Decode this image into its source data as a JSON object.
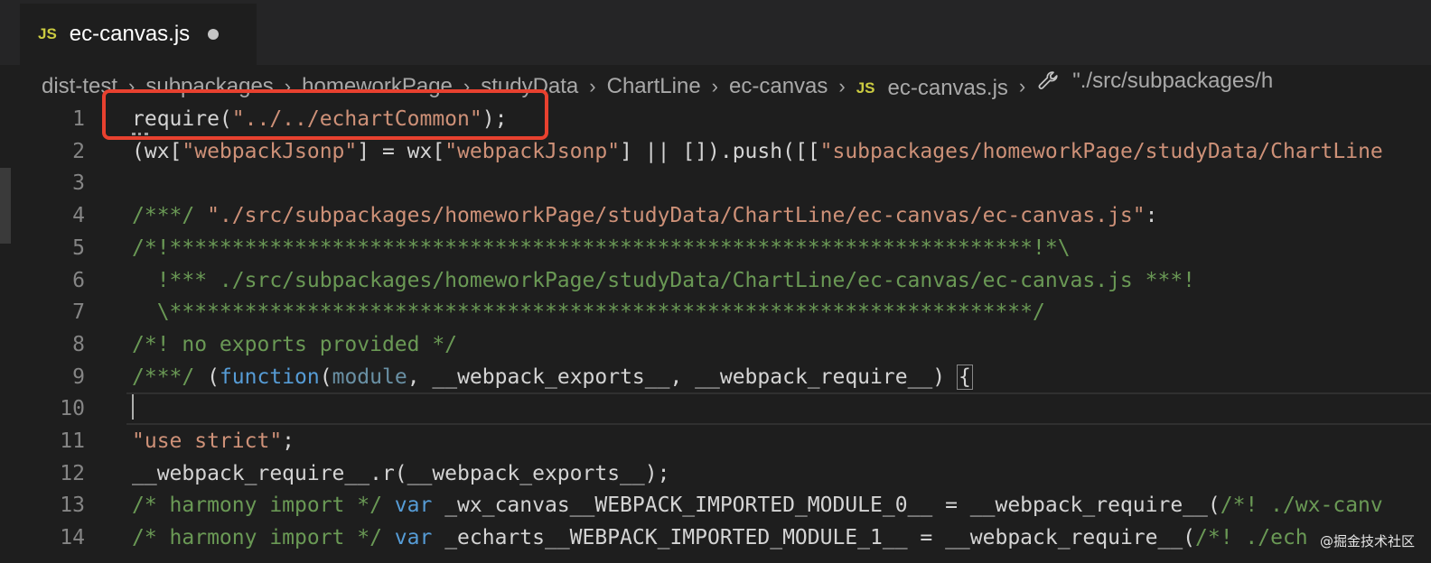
{
  "tab": {
    "icon": "JS",
    "label": "ec-canvas.js",
    "dirty_indicator": "unsaved-dot"
  },
  "breadcrumb": {
    "items": [
      "dist-test",
      "subpackages",
      "homeworkPage",
      "studyData",
      "ChartLine",
      "ec-canvas"
    ],
    "file_icon": "JS",
    "file": "ec-canvas.js",
    "symbol_icon": "wrench-icon",
    "symbol": "\"./src/subpackages/h"
  },
  "editor": {
    "lines": [
      {
        "number": "1",
        "tokens": [
          [
            "require(",
            "plain"
          ],
          [
            "\"../../echartCommon\"",
            "str"
          ],
          [
            ");",
            "plain"
          ]
        ]
      },
      {
        "number": "2",
        "tokens": [
          [
            "(wx[",
            "plain"
          ],
          [
            "\"webpackJsonp\"",
            "str"
          ],
          [
            "] = wx[",
            "plain"
          ],
          [
            "\"webpackJsonp\"",
            "str"
          ],
          [
            "] || []).push([[",
            "plain"
          ],
          [
            "\"subpackages/homeworkPage/studyData/ChartLine",
            "str"
          ]
        ]
      },
      {
        "number": "3",
        "tokens": []
      },
      {
        "number": "4",
        "tokens": [
          [
            "/***/ ",
            "com"
          ],
          [
            "\"./src/subpackages/homeworkPage/studyData/ChartLine/ec-canvas/ec-canvas.js\"",
            "str"
          ],
          [
            ":",
            "plain"
          ]
        ]
      },
      {
        "number": "5",
        "tokens": [
          [
            "/*!*********************************************************************!*\\",
            "com"
          ]
        ]
      },
      {
        "number": "6",
        "tokens": [
          [
            "  !*** ./src/subpackages/homeworkPage/studyData/ChartLine/ec-canvas/ec-canvas.js ***!",
            "com"
          ]
        ]
      },
      {
        "number": "7",
        "tokens": [
          [
            "  \\*********************************************************************/",
            "com"
          ]
        ]
      },
      {
        "number": "8",
        "tokens": [
          [
            "/*! no exports provided */",
            "com"
          ]
        ]
      },
      {
        "number": "9",
        "tokens": [
          [
            "/***/ ",
            "com"
          ],
          [
            "(",
            "plain"
          ],
          [
            "function",
            "kw"
          ],
          [
            "(",
            "plain"
          ],
          [
            "module",
            "param"
          ],
          [
            ", __webpack_exports__, __webpack_require__) ",
            "plain"
          ],
          [
            "{",
            "brace"
          ]
        ]
      },
      {
        "number": "10",
        "tokens": [
          [
            "",
            "cursor"
          ]
        ]
      },
      {
        "number": "11",
        "tokens": [
          [
            "\"use strict\"",
            "str"
          ],
          [
            ";",
            "plain"
          ]
        ]
      },
      {
        "number": "12",
        "tokens": [
          [
            "__webpack_require__.r(__webpack_exports__);",
            "plain"
          ]
        ]
      },
      {
        "number": "13",
        "tokens": [
          [
            "/* harmony import */ ",
            "com"
          ],
          [
            "var",
            "kw"
          ],
          [
            " _wx_canvas__WEBPACK_IMPORTED_MODULE_0__ = __webpack_require__(",
            "plain"
          ],
          [
            "/*! ./wx-canv",
            "com"
          ]
        ]
      },
      {
        "number": "14",
        "tokens": [
          [
            "/* harmony import */ ",
            "com"
          ],
          [
            "var",
            "kw"
          ],
          [
            " _echarts__WEBPACK_IMPORTED_MODULE_1__ = __webpack_require__(",
            "plain"
          ],
          [
            "/*! ./ech",
            "com"
          ]
        ]
      }
    ],
    "current_line": "10"
  },
  "watermark": "@掘金技术社区",
  "colors": {
    "background": "#1e1e1e",
    "tabbar": "#252526",
    "string": "#ce9178",
    "comment": "#6a9955",
    "keyword": "#569cd6",
    "highlight_box": "#e8412f",
    "js_icon": "#cbcb41"
  }
}
